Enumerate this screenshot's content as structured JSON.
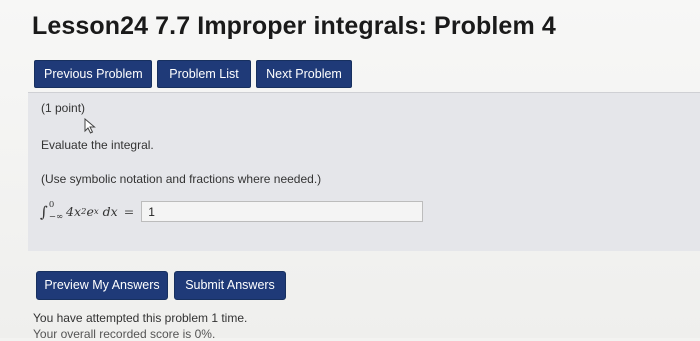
{
  "page": {
    "title": "Lesson24 7.7 Improper integrals: Problem 4"
  },
  "nav": {
    "previous": "Previous Problem",
    "list": "Problem List",
    "next": "Next Problem"
  },
  "problem": {
    "points": "(1 point)",
    "prompt": "Evaluate the integral.",
    "hint": "(Use symbolic notation and fractions where needed.)",
    "integral": {
      "lower": "−∞",
      "upper": "0",
      "integrand_coef": "4",
      "var": "x",
      "exp1": "2",
      "e": "e",
      "exp2": "x",
      "dx": "dx",
      "equals": "="
    },
    "answer_value": "1"
  },
  "actions": {
    "preview": "Preview My Answers",
    "submit": "Submit Answers"
  },
  "status": {
    "attempts": "You have attempted this problem 1 time.",
    "score": "Your overall recorded score is 0%."
  },
  "colors": {
    "button_bg": "#1f3a78",
    "problem_bg": "#e5e6ea",
    "page_bg": "#f3f3f1"
  },
  "icons": {
    "cursor": "mouse-pointer-icon"
  }
}
